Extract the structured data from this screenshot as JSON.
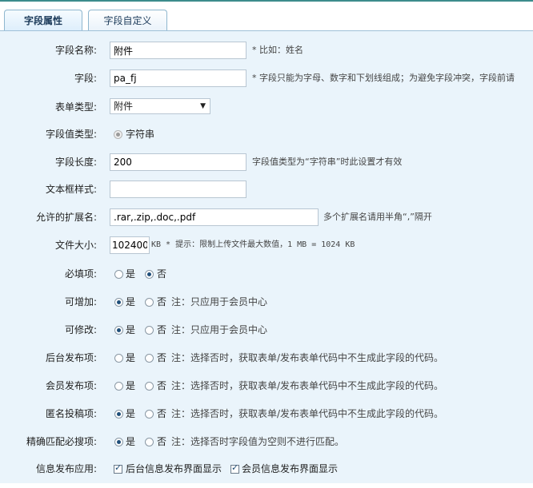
{
  "tabs": [
    "字段属性",
    "字段自定义"
  ],
  "fields": {
    "name": {
      "label": "字段名称:",
      "value": "附件",
      "hint": "* 比如：姓名"
    },
    "field": {
      "label": "字段:",
      "value": "pa_fj",
      "hint": "* 字段只能为字母、数字和下划线组成；为避免字段冲突，字段前请"
    },
    "form_type": {
      "label": "表单类型:",
      "value": "附件"
    },
    "value_type": {
      "label": "字段值类型:",
      "option": "字符串"
    },
    "length": {
      "label": "字段长度:",
      "value": "200",
      "hint": "字段值类型为“字符串”时此设置才有效"
    },
    "textbox_style": {
      "label": "文本框样式:",
      "value": ""
    },
    "extensions": {
      "label": "允许的扩展名:",
      "value": ".rar,.zip,.doc,.pdf",
      "hint": "多个扩展名请用半角“,”隔开"
    },
    "file_size": {
      "label": "文件大小:",
      "value": "102400",
      "hint": "KB * 提示：限制上传文件最大数值，1 MB = 1024 KB"
    },
    "required": {
      "label": "必填项:",
      "yes": "是",
      "no": "否",
      "selected": "no"
    },
    "addable": {
      "label": "可增加:",
      "yes": "是",
      "no": "否",
      "selected": "yes",
      "note": "注：只应用于会员中心"
    },
    "editable": {
      "label": "可修改:",
      "yes": "是",
      "no": "否",
      "selected": "yes",
      "note": "注：只应用于会员中心"
    },
    "backend_publish": {
      "label": "后台发布项:",
      "yes": "是",
      "no": "否",
      "selected": "none",
      "note": "注：选择否时，获取表单/发布表单代码中不生成此字段的代码。"
    },
    "member_publish": {
      "label": "会员发布项:",
      "yes": "是",
      "no": "否",
      "selected": "none",
      "note": "注：选择否时，获取表单/发布表单代码中不生成此字段的代码。"
    },
    "anon_submit": {
      "label": "匿名投稿项:",
      "yes": "是",
      "no": "否",
      "selected": "yes",
      "note": "注：选择否时，获取表单/发布表单代码中不生成此字段的代码。"
    },
    "exact_match": {
      "label": "精确匹配必搜项:",
      "yes": "是",
      "no": "否",
      "selected": "yes",
      "note": "注：选择否时字段值为空则不进行匹配。"
    },
    "info_publish": {
      "label": "信息发布应用:",
      "opt1": "后台信息发布界面显示",
      "opt2": "会员信息发布界面显示"
    }
  }
}
